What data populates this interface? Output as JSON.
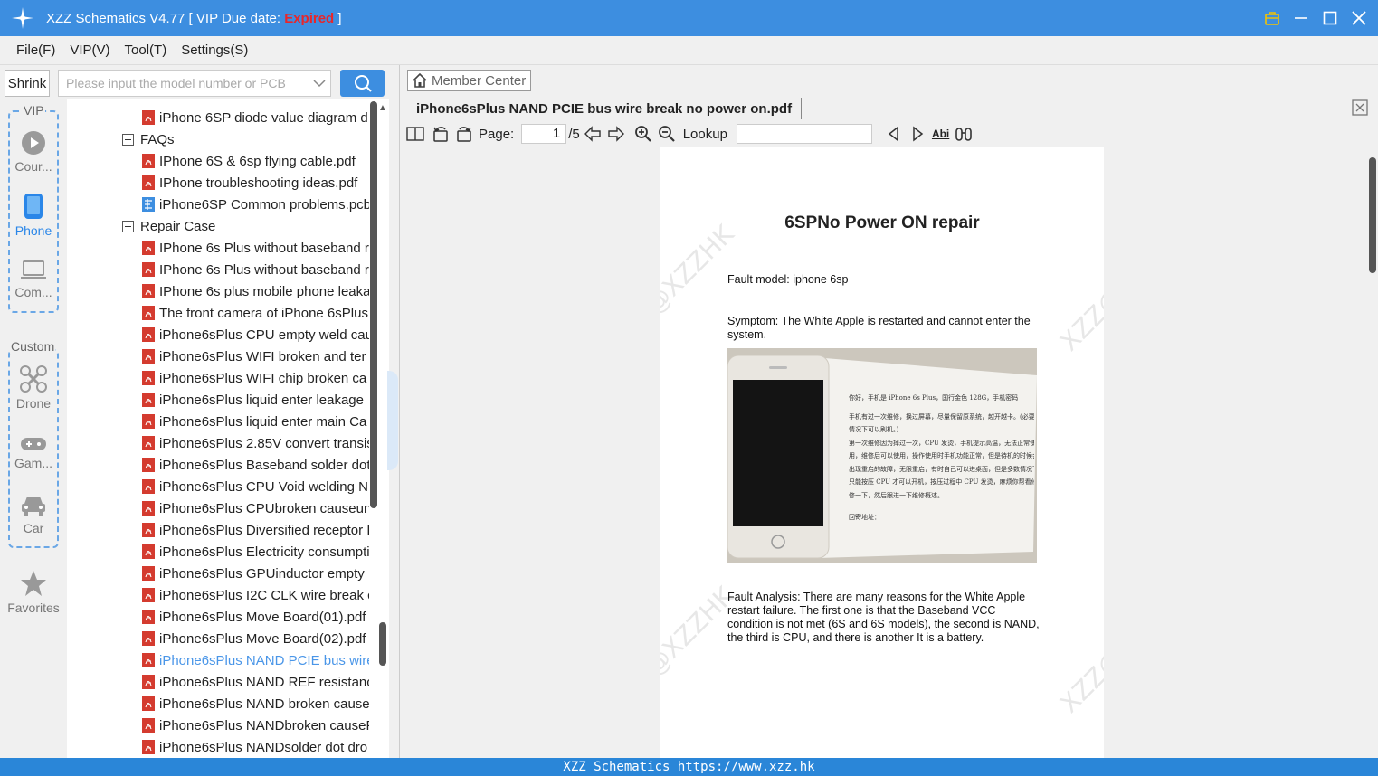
{
  "titlebar": {
    "app_title": "XZZ Schematics V4.77 [ VIP Due date: ",
    "expired": "Expired",
    "suffix": " ]"
  },
  "menu": [
    "File(F)",
    "VIP(V)",
    "Tool(T)",
    "Settings(S)"
  ],
  "shrink_label": "Shrink",
  "search": {
    "placeholder": "Please input the model number or PCB"
  },
  "rail": {
    "vip_label": "VIP",
    "custom_label": "Custom",
    "items": [
      {
        "label": "Cour...",
        "icon": "play-circle-icon"
      },
      {
        "label": "Phone",
        "icon": "phone-icon"
      },
      {
        "label": "Com...",
        "icon": "laptop-icon"
      },
      {
        "label": "Drone",
        "icon": "drone-icon"
      },
      {
        "label": "Gam...",
        "icon": "gamepad-icon"
      },
      {
        "label": "Car",
        "icon": "car-icon"
      },
      {
        "label": "Favorites",
        "icon": "star-icon"
      }
    ]
  },
  "tree": {
    "rows": [
      {
        "text": "iPhone 6SP diode value diagram d",
        "type": "pdf"
      },
      {
        "text": "FAQs",
        "type": "folder"
      },
      {
        "text": "IPhone 6S & 6sp flying cable.pdf",
        "type": "pdf"
      },
      {
        "text": "IPhone troubleshooting ideas.pdf",
        "type": "pdf"
      },
      {
        "text": "iPhone6SP Common problems.pcb",
        "type": "pcb"
      },
      {
        "text": "Repair Case",
        "type": "folder"
      },
      {
        "text": "IPhone 6s Plus without baseband r",
        "type": "pdf"
      },
      {
        "text": "IPhone 6s Plus without baseband r",
        "type": "pdf"
      },
      {
        "text": "IPhone 6s plus mobile phone leaka",
        "type": "pdf"
      },
      {
        "text": "The front camera of iPhone 6sPlus",
        "type": "pdf"
      },
      {
        "text": "iPhone6sPlus  CPU empty weld cau",
        "type": "pdf"
      },
      {
        "text": "iPhone6sPlus  WIFI broken and ter",
        "type": "pdf"
      },
      {
        "text": "iPhone6sPlus  WIFI chip broken ca",
        "type": "pdf"
      },
      {
        "text": "iPhone6sPlus  liquid enter leakage",
        "type": "pdf"
      },
      {
        "text": "iPhone6sPlus  liquid enter main Ca",
        "type": "pdf"
      },
      {
        "text": "iPhone6sPlus 2.85V convert transis",
        "type": "pdf"
      },
      {
        "text": "iPhone6sPlus Baseband solder dot",
        "type": "pdf"
      },
      {
        "text": "iPhone6sPlus CPU Void welding N",
        "type": "pdf"
      },
      {
        "text": "iPhone6sPlus CPUbroken causeun",
        "type": "pdf"
      },
      {
        "text": "iPhone6sPlus Diversified receptor I",
        "type": "pdf"
      },
      {
        "text": "iPhone6sPlus Electricity consumpti",
        "type": "pdf"
      },
      {
        "text": "iPhone6sPlus GPUinductor empty",
        "type": "pdf"
      },
      {
        "text": "iPhone6sPlus I2C CLK wire break  c",
        "type": "pdf"
      },
      {
        "text": "iPhone6sPlus Move Board(01).pdf",
        "type": "pdf"
      },
      {
        "text": "iPhone6sPlus Move Board(02).pdf",
        "type": "pdf"
      },
      {
        "text": "iPhone6sPlus NAND PCIE bus wire",
        "type": "pdf",
        "selected": true
      },
      {
        "text": "iPhone6sPlus NAND REF resistance",
        "type": "pdf"
      },
      {
        "text": "iPhone6sPlus NAND broken cause",
        "type": "pdf"
      },
      {
        "text": "iPhone6sPlus NANDbroken causeF",
        "type": "pdf"
      },
      {
        "text": "iPhone6sPlus NANDsolder dot dro",
        "type": "pdf"
      }
    ]
  },
  "viewer": {
    "member_center": "Member Center",
    "tab_title": "iPhone6sPlus NAND PCIE bus wire break  no power on.pdf",
    "page_label": "Page:",
    "page_current": "1",
    "page_total": "/5",
    "lookup_label": "Lookup",
    "abi_label": "Abi"
  },
  "document": {
    "title": "6SPNo Power ON repair",
    "fault_model": "Fault model: iphone 6sp",
    "symptom": "Symptom: The White Apple is restarted and cannot enter the system.",
    "analysis": "Fault Analysis: There are many reasons for the White Apple restart failure. The first one is that the Baseband VCC condition is not met (6S and 6S models), the second is NAND, the third is CPU, and there is another It is a battery.",
    "watermark": "XZZ@XZZHK",
    "note_lines": [
      "你好，手机是 iPhone 6s Plus，国行金色 128G，手机密码",
      "手机有过一次维修，换过屏幕，尽量保留原系统，越开越卡。(必要",
      "情况下可以刷机。)",
      "第一次维修因为摔过一次，CPU 发烫，手机提示高温，无法正常使",
      "用，维修后可以使用，操作使用时手机功能正常，但是待机的时候会",
      "出现重启的故障，无限重启，有时自己可以进桌面，但是多数情况下，",
      "只能按压 CPU 才可以开机，按压过程中 CPU 发烫，麻烦你帮看修",
      "修一下，然后跟进一下维修概述。",
      "回寄地址："
    ]
  },
  "statusbar": "XZZ Schematics https://www.xzz.hk"
}
